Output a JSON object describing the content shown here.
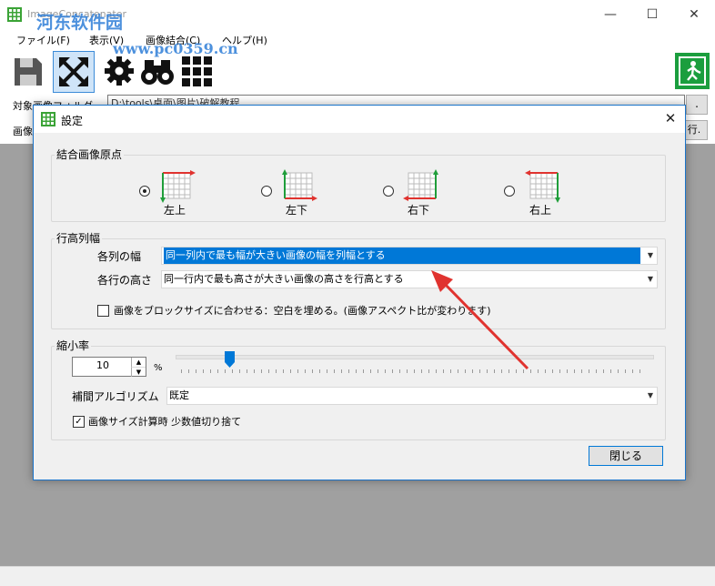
{
  "app": {
    "title": "ImageConcatenater",
    "watermark": "河东软件园",
    "watermark_url": "www.pc0359.cn"
  },
  "menu": [
    "ファイル(F)",
    "表示(V)",
    "画像結合(C)",
    "ヘルプ(H)"
  ],
  "window_controls": {
    "minimize": "—",
    "maximize": "☐",
    "close": "✕"
  },
  "main": {
    "folder_label": "対象画像フォルダ",
    "folder_value": "D:\\tools\\桌面\\图片\\破解教程",
    "browse_label": ".",
    "image_label": "画像",
    "exec_label": "行."
  },
  "dialog": {
    "title": "設定",
    "close": "✕",
    "origin": {
      "title": "結合画像原点",
      "options": [
        {
          "label": "左上",
          "selected": true
        },
        {
          "label": "左下",
          "selected": false
        },
        {
          "label": "右下",
          "selected": false
        },
        {
          "label": "右上",
          "selected": false
        }
      ]
    },
    "rowcol": {
      "title": "行高列幅",
      "col_label": "各列の幅",
      "col_value": "同一列内で最も幅が大きい画像の幅を列幅とする",
      "row_label": "各行の高さ",
      "row_value": "同一行内で最も高さが大きい画像の高さを行高とする",
      "fit_checkbox_label": "画像をブロックサイズに合わせる：空白を埋める。(画像アスペクト比が変わります)",
      "fit_checked": false
    },
    "scale": {
      "title": "縮小率",
      "value": "10",
      "unit": "%",
      "slider_fraction": 0.1,
      "interp_label": "補間アルゴリズム",
      "interp_value": "既定",
      "round_checkbox_label": "画像サイズ計算時 少数値切り捨て",
      "round_checked": true
    },
    "close_button": "閉じる"
  },
  "colors": {
    "accent": "#0078d7",
    "annotation_arrow": "#e0332f",
    "corner_green": "#1f9e3a",
    "corner_red": "#e0332f",
    "exit_icon": "#1b9e3e"
  }
}
